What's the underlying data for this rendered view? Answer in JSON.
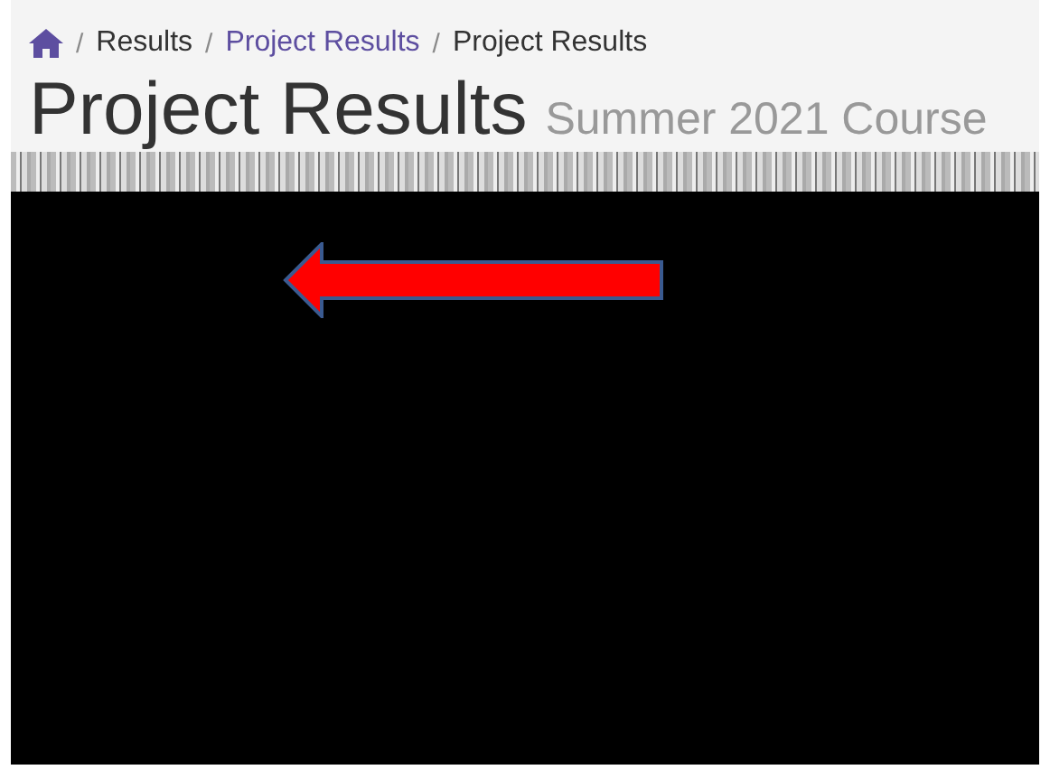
{
  "breadcrumb": [
    {
      "kind": "home"
    },
    {
      "kind": "text",
      "label": "Results"
    },
    {
      "kind": "link",
      "label": "Project Results"
    },
    {
      "kind": "current",
      "label": "Project Results"
    }
  ],
  "breadcrumb_separator": "/",
  "heading": {
    "title": "Project Results",
    "subtitle": "Summer 2021 Course"
  }
}
